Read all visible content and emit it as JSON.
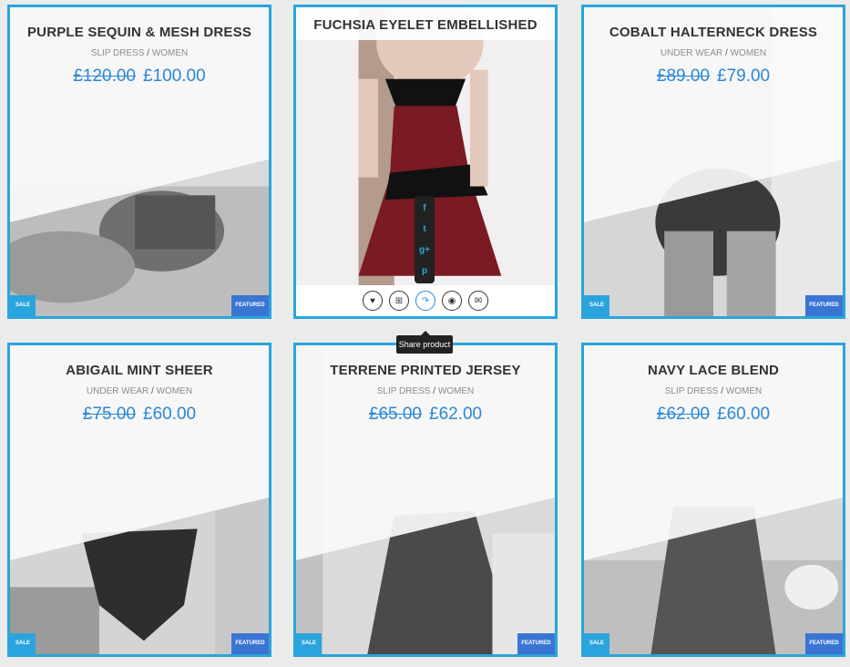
{
  "products": [
    {
      "title": "PURPLE SEQUIN & MESH DRESS",
      "category": "SLIP DRESS",
      "parent": "WOMEN",
      "old_price": "£120.00",
      "price": "£100.00",
      "sale": "SALE",
      "featured": "FEATURED"
    },
    {
      "title": "FUCHSIA EYELET EMBELLISHED",
      "category": "",
      "parent": "",
      "old_price": "",
      "price": "",
      "sale": "",
      "featured": ""
    },
    {
      "title": "COBALT HALTERNECK DRESS",
      "category": "UNDER WEAR",
      "parent": "WOMEN",
      "old_price": "£89.00",
      "price": "£79.00",
      "sale": "SALE",
      "featured": "FEATURED"
    },
    {
      "title": "ABIGAIL MINT SHEER",
      "category": "UNDER WEAR",
      "parent": "WOMEN",
      "old_price": "£75.00",
      "price": "£60.00",
      "sale": "SALE",
      "featured": "FEATURED"
    },
    {
      "title": "TERRENE PRINTED JERSEY",
      "category": "SLIP DRESS",
      "parent": "WOMEN",
      "old_price": "£65.00",
      "price": "£62.00",
      "sale": "SALE",
      "featured": "FEATURED"
    },
    {
      "title": "NAVY LACE BLEND",
      "category": "SLIP DRESS",
      "parent": "WOMEN",
      "old_price": "£62.00",
      "price": "£60.00",
      "sale": "SALE",
      "featured": "FEATURED"
    }
  ],
  "separator": "/",
  "tooltip": "Share product",
  "icons": {
    "wishlist": "heart-icon",
    "cart": "cart-icon",
    "share": "share-icon",
    "quickview": "eye-icon",
    "email": "envelope-icon",
    "facebook": "facebook-icon",
    "twitter": "twitter-icon",
    "googleplus": "google-plus-icon",
    "pinterest": "pinterest-icon"
  },
  "glyphs": {
    "facebook": "f",
    "twitter": "t",
    "googleplus": "g+",
    "pinterest": "p",
    "wishlist": "♥",
    "cart": "⊞",
    "share": "↷",
    "quickview": "◉",
    "email": "✉"
  },
  "colors": {
    "border": "#2aa4dc",
    "price": "#2a87d8",
    "sale_badge": "#2aa4dc",
    "featured_badge": "#3a75d4"
  }
}
